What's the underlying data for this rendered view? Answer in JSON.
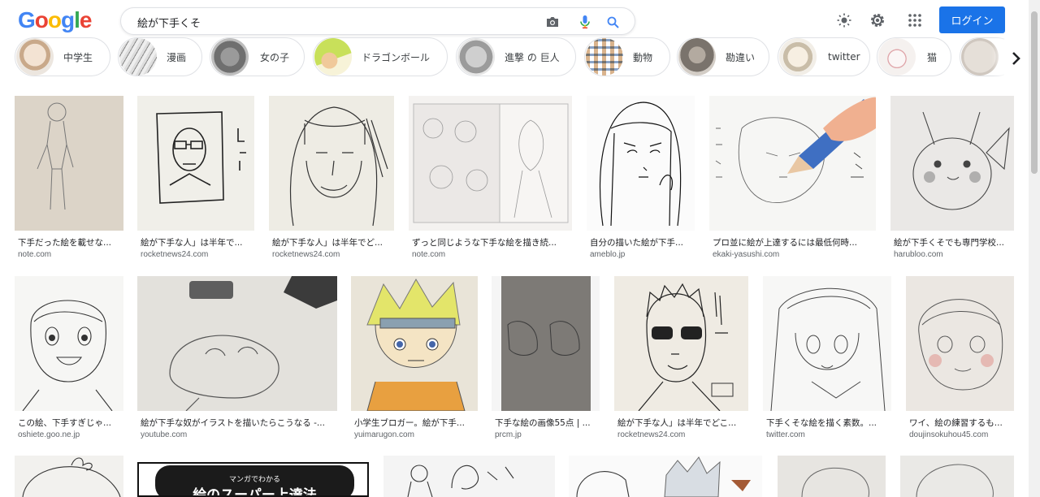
{
  "logo": {
    "letters": [
      "G",
      "o",
      "o",
      "g",
      "l",
      "e"
    ],
    "colors": [
      "#4285F4",
      "#EA4335",
      "#FBBC05",
      "#4285F4",
      "#34A853",
      "#EA4335"
    ]
  },
  "search": {
    "query": "絵が下手くそ"
  },
  "header": {
    "login_label": "ログイン"
  },
  "chips": [
    {
      "label": "中学生"
    },
    {
      "label": "漫画"
    },
    {
      "label": "女の子"
    },
    {
      "label": "ドラゴンボール"
    },
    {
      "label": "進撃 の 巨人"
    },
    {
      "label": "動物"
    },
    {
      "label": "勘違い"
    },
    {
      "label": "twitter"
    },
    {
      "label": "猫"
    },
    {
      "label": ""
    }
  ],
  "results": [
    {
      "title": "下手だった絵を載せな...",
      "source": "note.com"
    },
    {
      "title": "絵が下手な人」は半年で...",
      "source": "rocketnews24.com"
    },
    {
      "title": "絵が下手な人」は半年でど...",
      "source": "rocketnews24.com"
    },
    {
      "title": "ずっと同じような下手な絵を描き続...",
      "source": "note.com"
    },
    {
      "title": "自分の描いた絵が下手...",
      "source": "ameblo.jp"
    },
    {
      "title": "プロ並に絵が上達するには最低何時...",
      "source": "ekaki-yasushi.com"
    },
    {
      "title": "絵が下手くそでも専門学校...",
      "source": "harubloo.com"
    },
    {
      "title": "この絵、下手すぎじゃ...",
      "source": "oshiete.goo.ne.jp"
    },
    {
      "title": "絵が下手な奴がイラストを描いたらこうなる -...",
      "source": "youtube.com"
    },
    {
      "title": "小学生ブロガー。絵が下手...",
      "source": "yuimarugon.com"
    },
    {
      "title": "下手な絵の画像55点 | ...",
      "source": "prcm.jp"
    },
    {
      "title": "絵が下手な人」は半年でどこ...",
      "source": "rocketnews24.com"
    },
    {
      "title": "下手くそな絵を描く素数。...",
      "source": "twitter.com"
    },
    {
      "title": "ワイ、絵の練習するも...",
      "source": "doujinsokuhou45.com"
    },
    {
      "title": "",
      "source": ""
    },
    {
      "title": "",
      "source": ""
    },
    {
      "title": "",
      "source": ""
    },
    {
      "title": "",
      "source": ""
    },
    {
      "title": "",
      "source": ""
    },
    {
      "title": "",
      "source": ""
    }
  ],
  "manga_book": {
    "line1": "マンガでわかる",
    "line2": "絵のスーパー上達法"
  },
  "colors": {
    "accent": "#1a73e8",
    "paper": "#f2f0ec",
    "pencil": "#555555"
  }
}
